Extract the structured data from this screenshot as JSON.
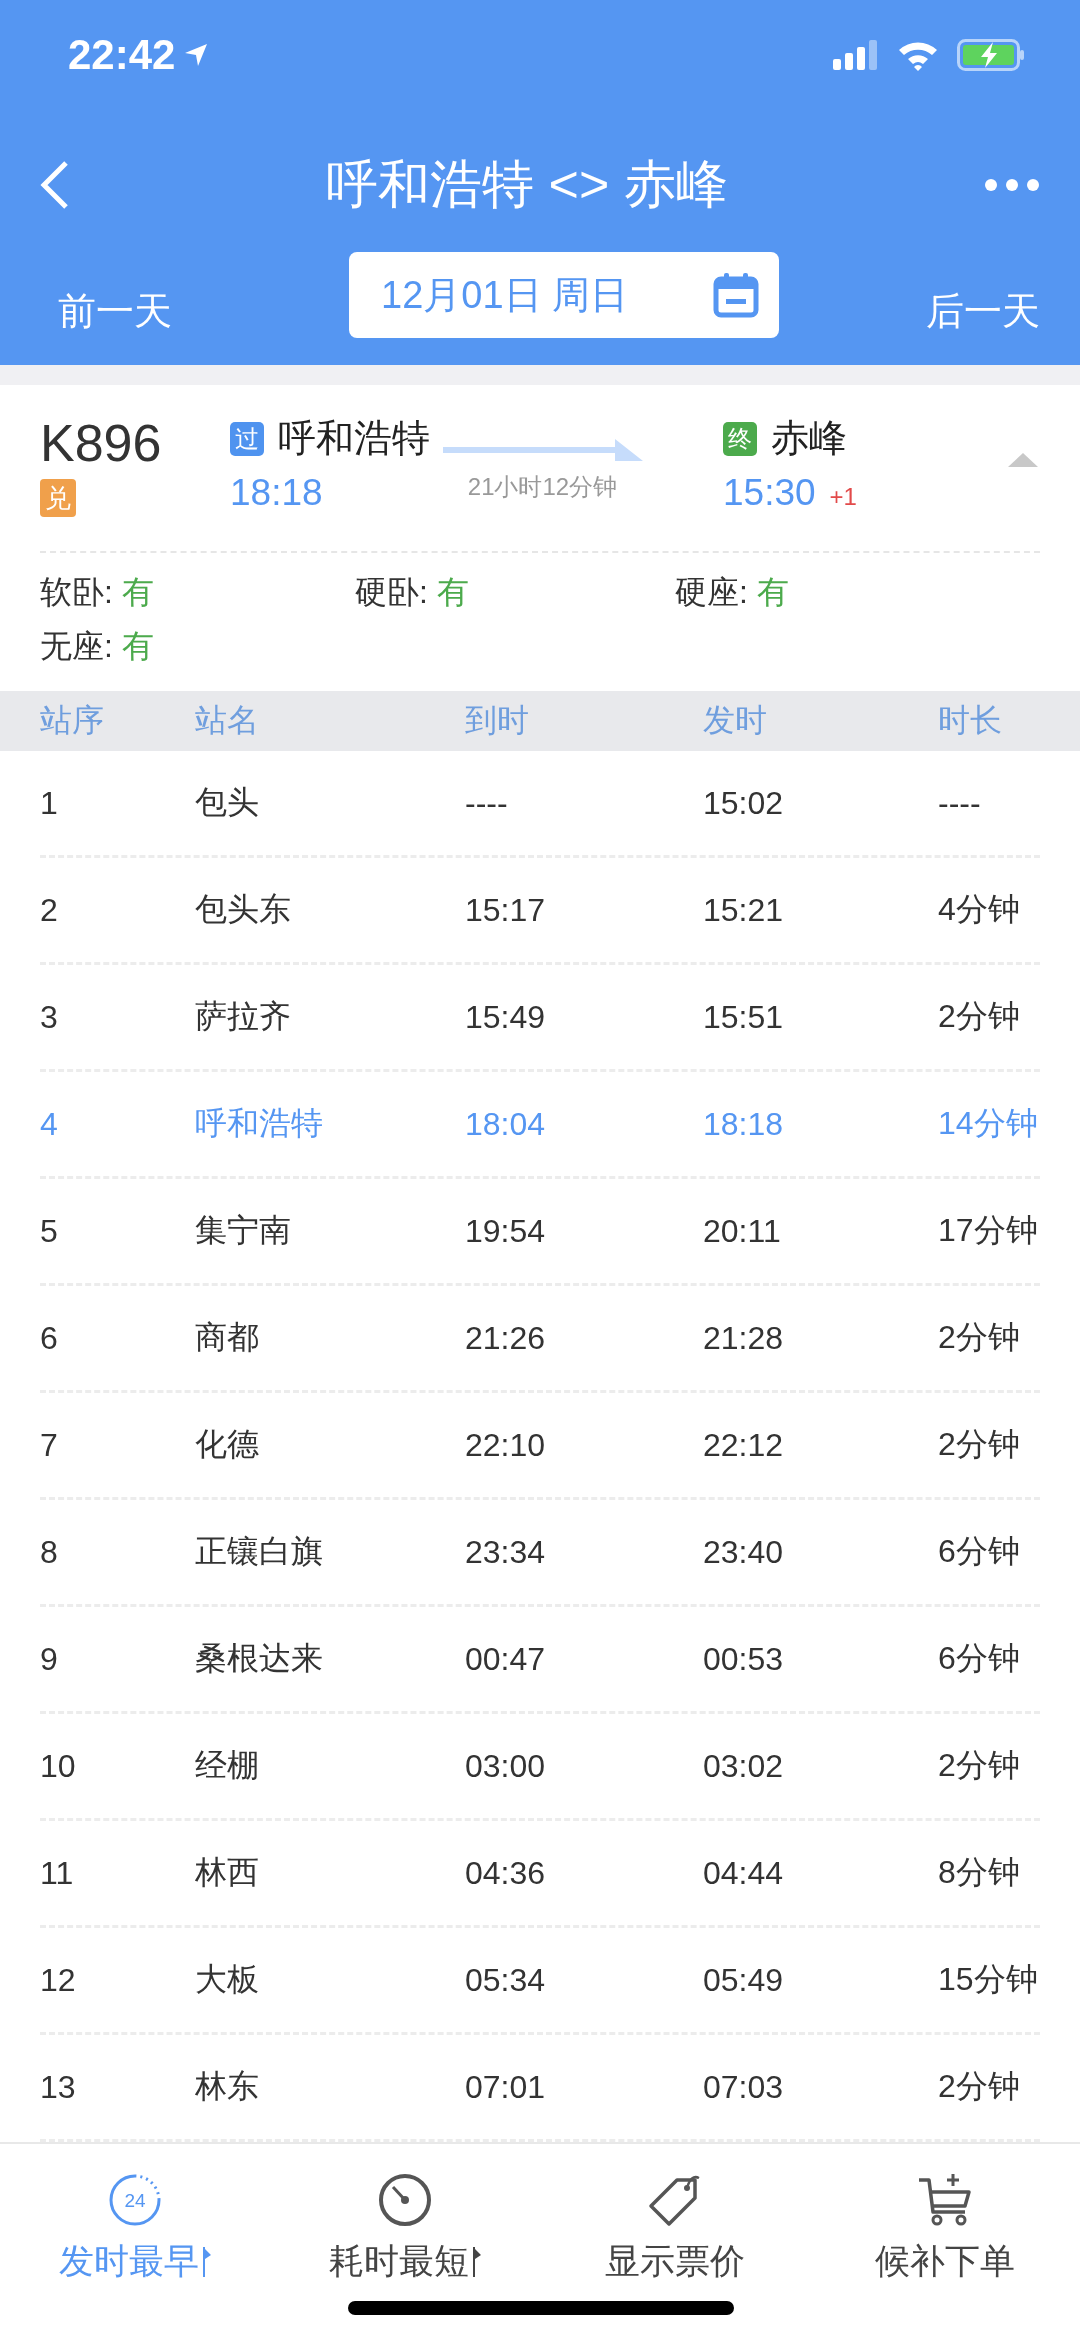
{
  "status_bar": {
    "time": "22:42"
  },
  "header": {
    "title": "呼和浩特 <> 赤峰",
    "prev_day": "前一天",
    "date": "12月01日 周日",
    "next_day": "后一天"
  },
  "train": {
    "number": "K896",
    "tag": "兑",
    "from": {
      "badge": "过",
      "station": "呼和浩特",
      "time": "18:18"
    },
    "duration": "21小时12分钟",
    "to": {
      "badge": "终",
      "station": "赤峰",
      "time": "15:30",
      "day_offset": "+1"
    },
    "expanded": true,
    "seats": [
      {
        "label": "软卧:",
        "value": "有"
      },
      {
        "label": "硬卧:",
        "value": "有"
      },
      {
        "label": "硬座:",
        "value": "有"
      },
      {
        "label": "无座:",
        "value": "有"
      }
    ]
  },
  "table": {
    "columns": [
      "站序",
      "站名",
      "到时",
      "发时",
      "时长"
    ],
    "rows": [
      {
        "cells": [
          "1",
          "包头",
          "----",
          "15:02",
          "----"
        ],
        "highlighted": false
      },
      {
        "cells": [
          "2",
          "包头东",
          "15:17",
          "15:21",
          "4分钟"
        ],
        "highlighted": false
      },
      {
        "cells": [
          "3",
          "萨拉齐",
          "15:49",
          "15:51",
          "2分钟"
        ],
        "highlighted": false
      },
      {
        "cells": [
          "4",
          "呼和浩特",
          "18:04",
          "18:18",
          "14分钟"
        ],
        "highlighted": true
      },
      {
        "cells": [
          "5",
          "集宁南",
          "19:54",
          "20:11",
          "17分钟"
        ],
        "highlighted": false
      },
      {
        "cells": [
          "6",
          "商都",
          "21:26",
          "21:28",
          "2分钟"
        ],
        "highlighted": false
      },
      {
        "cells": [
          "7",
          "化德",
          "22:10",
          "22:12",
          "2分钟"
        ],
        "highlighted": false
      },
      {
        "cells": [
          "8",
          "正镶白旗",
          "23:34",
          "23:40",
          "6分钟"
        ],
        "highlighted": false
      },
      {
        "cells": [
          "9",
          "桑根达来",
          "00:47",
          "00:53",
          "6分钟"
        ],
        "highlighted": false
      },
      {
        "cells": [
          "10",
          "经棚",
          "03:00",
          "03:02",
          "2分钟"
        ],
        "highlighted": false
      },
      {
        "cells": [
          "11",
          "林西",
          "04:36",
          "04:44",
          "8分钟"
        ],
        "highlighted": false
      },
      {
        "cells": [
          "12",
          "大板",
          "05:34",
          "05:49",
          "15分钟"
        ],
        "highlighted": false
      },
      {
        "cells": [
          "13",
          "林东",
          "07:01",
          "07:03",
          "2分钟"
        ],
        "highlighted": false
      }
    ]
  },
  "bottom_bar": [
    {
      "kind": "clock24",
      "icon_text": "24",
      "label": "发时最早",
      "sort": true,
      "selected": true
    },
    {
      "kind": "timer",
      "label": "耗时最短",
      "sort": true,
      "selected": false
    },
    {
      "kind": "tag",
      "label": "显示票价",
      "sort": false,
      "selected": false
    },
    {
      "kind": "cart",
      "label": "候补下单",
      "sort": false,
      "selected": false
    }
  ]
}
